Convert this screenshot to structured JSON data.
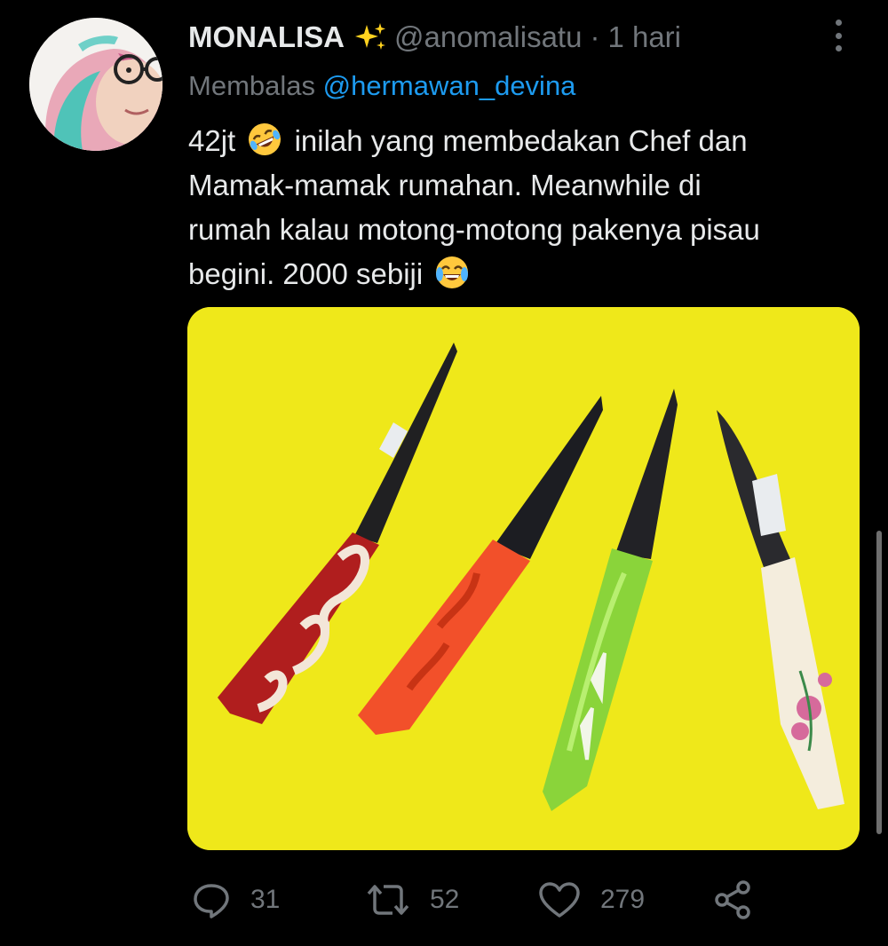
{
  "tweet": {
    "author_name": "MONALISA",
    "author_handle": "@anomalisatu",
    "separator": "·",
    "time": "1 hari",
    "reply_prefix": "Membalas",
    "reply_mention": "@hermawan_devina",
    "text_lines": [
      "42jt",
      "inilah yang membedakan Chef dan",
      "Mamak-mamak rumahan. Meanwhile di",
      "rumah kalau motong-motong pakenya pisau",
      "begini. 2000 sebiji"
    ],
    "emojis": [
      "rolling-on-floor-laughing",
      "face-with-tears-of-joy",
      "sparkles"
    ]
  },
  "media": {
    "background_color": "#efe81a",
    "knives": [
      {
        "handle_color": "#b01e1e",
        "pattern_color": "#f3e6d8"
      },
      {
        "handle_color": "#f2502a",
        "pattern_color": "#c83314"
      },
      {
        "handle_color": "#8ad43a",
        "pattern_color": "#f2f6e8"
      },
      {
        "handle_color": "#f4eddd",
        "pattern_color": "#d66a9b"
      }
    ]
  },
  "actions": {
    "reply_count": "31",
    "retweet_count": "52",
    "like_count": "279"
  },
  "colors": {
    "background": "#000000",
    "primary_text": "#e7e9ea",
    "secondary_text": "#71767b",
    "link": "#1d9bf0"
  },
  "icons": [
    "more-icon",
    "reply-icon",
    "retweet-icon",
    "like-icon",
    "share-icon"
  ]
}
